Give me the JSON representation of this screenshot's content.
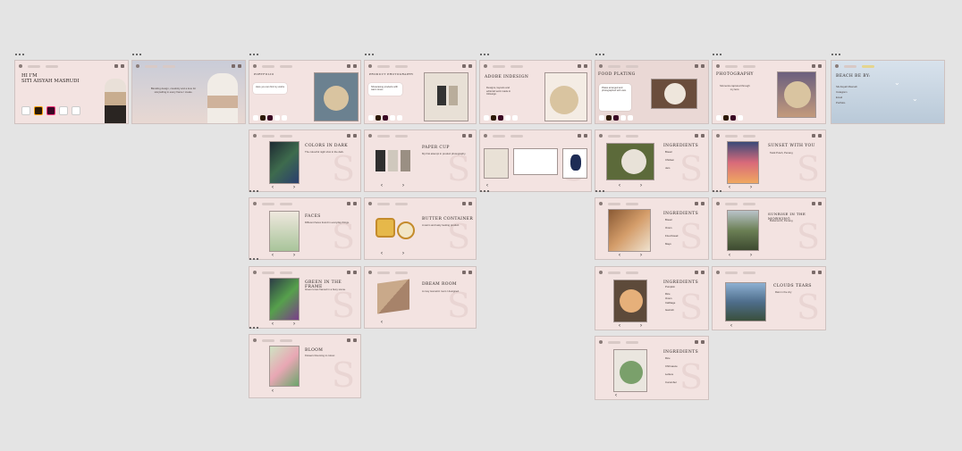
{
  "colors": {
    "canvas": "#e4e4e4",
    "slide": "#f3e3e1",
    "accent_nav": "#e5d58e"
  },
  "frames": {
    "intro": {
      "greeting": "HI I'M",
      "name": "SITI AISYAH MASRUDI",
      "tools": [
        "pen-tool-icon",
        "illustrator-icon",
        "indesign-icon",
        "docs-icon",
        "camera-icon"
      ]
    },
    "about": {
      "text": "Blending design, creativity and a love for storytelling in every frame I create."
    },
    "portfolio_a": {
      "heading": "PORTFOLIO",
      "text": "Here you can find my works"
    },
    "portfolio_b": {
      "heading": "PRODUCT PHOTOGRAPHY",
      "text": "Showcasing products with warm tones"
    },
    "adobe": {
      "heading": "ADOBE INDESIGN",
      "text": "Designs, layouts and editorial work made in InDesign."
    },
    "food": {
      "heading": "FOOD PLATING",
      "text": "Plates arranged and photographed with care."
    },
    "photography": {
      "heading": "PHOTOGRAPHY",
      "text": "Moments captured through my lens."
    },
    "beach": {
      "heading": "BEACH BE BY:",
      "lines": [
        "Siti Aisyah Masrudi",
        "Instagram",
        "Email",
        "Portfolio"
      ]
    },
    "colors_in_dark": {
      "heading": "COLORS IN DARK",
      "text": "The colourful night shot in the dark."
    },
    "paper_cup": {
      "heading": "PAPER CUP",
      "text": "My first attempt in product photography."
    },
    "faces": {
      "heading": "FACES",
      "text": "Different faces found in everyday things."
    },
    "butter": {
      "heading": "BUTTER CONTAINER",
      "text": "A warm and tasty looking product."
    },
    "green": {
      "heading": "GREEN IN THE FRAME",
      "text": "Green tones framed in a busy scene."
    },
    "dream": {
      "heading": "DREAM ROOM",
      "text": "A cosy isometric room I designed."
    },
    "bloom": {
      "heading": "BLOOM",
      "text": "Flowers blooming in colour."
    },
    "ingredients_1": {
      "heading": "INGREDIENTS",
      "items": [
        "Bread",
        "Chicken",
        "Jam"
      ]
    },
    "ingredients_2": {
      "heading": "INGREDIENTS",
      "items": [
        "Bread",
        "Onion",
        "Fried bread",
        "Mayo"
      ]
    },
    "ingredients_3": {
      "heading": "INGREDIENTS",
      "items": [
        "Pumpkin",
        "Rice",
        "Onion",
        "Cabbage",
        "Garnish"
      ]
    },
    "ingredients_4": {
      "heading": "INGREDIENTS",
      "items": [
        "Rice",
        "Chili sauce",
        "Lettuce",
        "Cucumber"
      ]
    },
    "sunset": {
      "heading": "SUNSET WITH YOU",
      "text": "Tasik Puteh, Penang"
    },
    "sunrise": {
      "heading": "SUNRISE IN THE MORNING",
      "text": "Butterworth, Penang"
    },
    "clouds": {
      "heading": "CLOUDS TEARS",
      "text": "Rain in the city"
    }
  },
  "arrows": {
    "prev": "‹",
    "next": "›"
  },
  "ghost_mark": "S"
}
